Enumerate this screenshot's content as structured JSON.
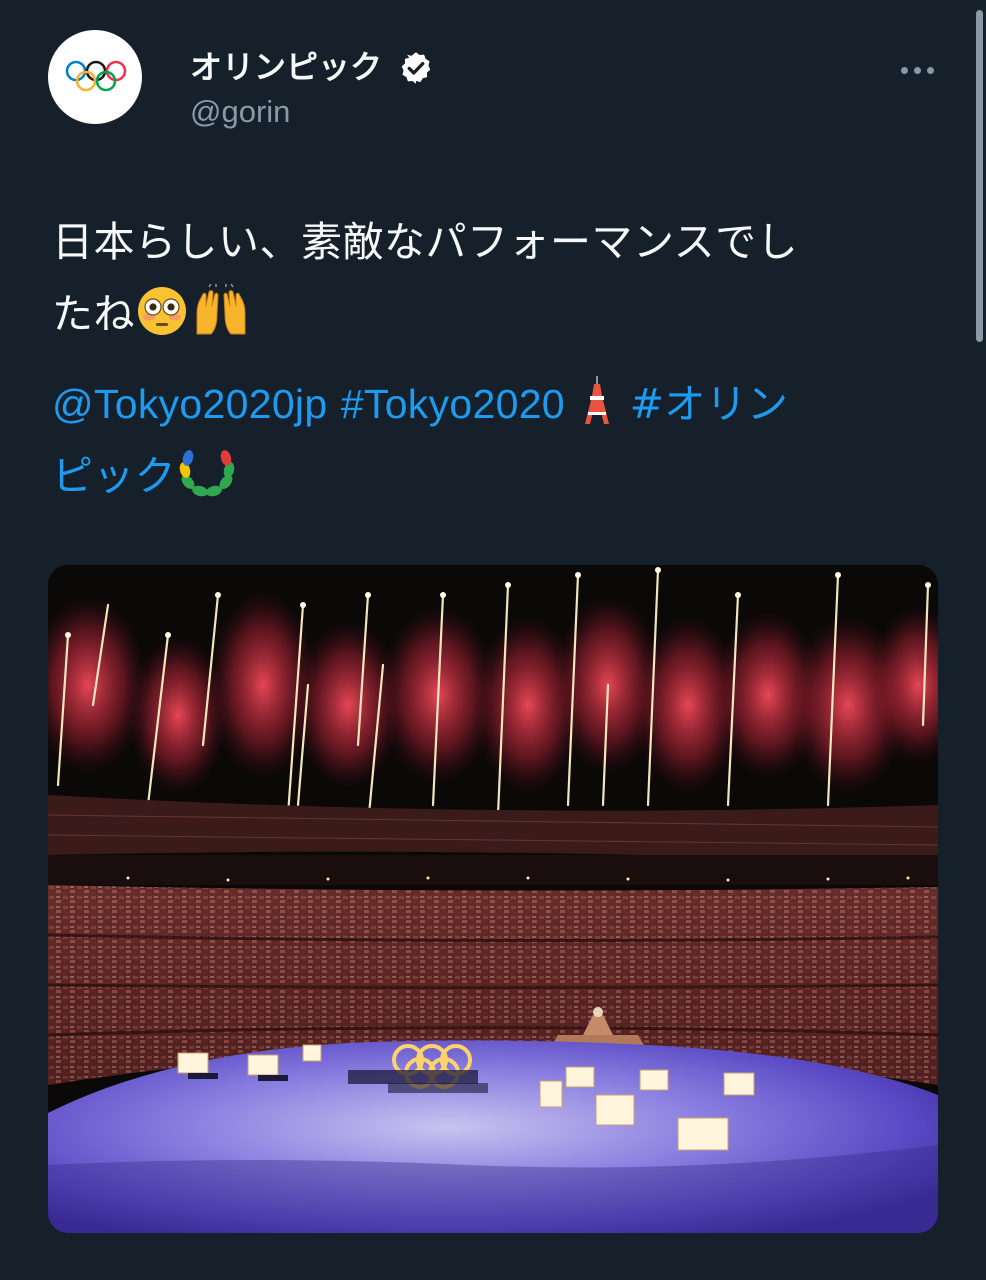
{
  "author": {
    "display_name": "オリンピック",
    "handle": "@gorin",
    "avatar_icon": "olympic-rings-icon",
    "verified_icon": "verified-badge-icon"
  },
  "more_icon": "more-dots-icon",
  "tweet": {
    "text_line1": "日本らしい、素敵なパフォーマンスでし",
    "text_line2": "たね",
    "emoji1": "flushed-face-emoji",
    "emoji2": "raising-hands-emoji",
    "mention": "@Tokyo2020jp",
    "hashtag1": "#Tokyo2020",
    "emoji3": "tokyo-tower-emoji",
    "hashtag2_part1": "#オリン",
    "hashtag2_part2": "ピック",
    "emoji4": "laurel-wreath-emoji"
  },
  "media": {
    "type": "photo"
  },
  "colors": {
    "background": "#15202b",
    "text": "#f7f9f9",
    "secondary": "#8b98a5",
    "link": "#1d9bf0"
  }
}
